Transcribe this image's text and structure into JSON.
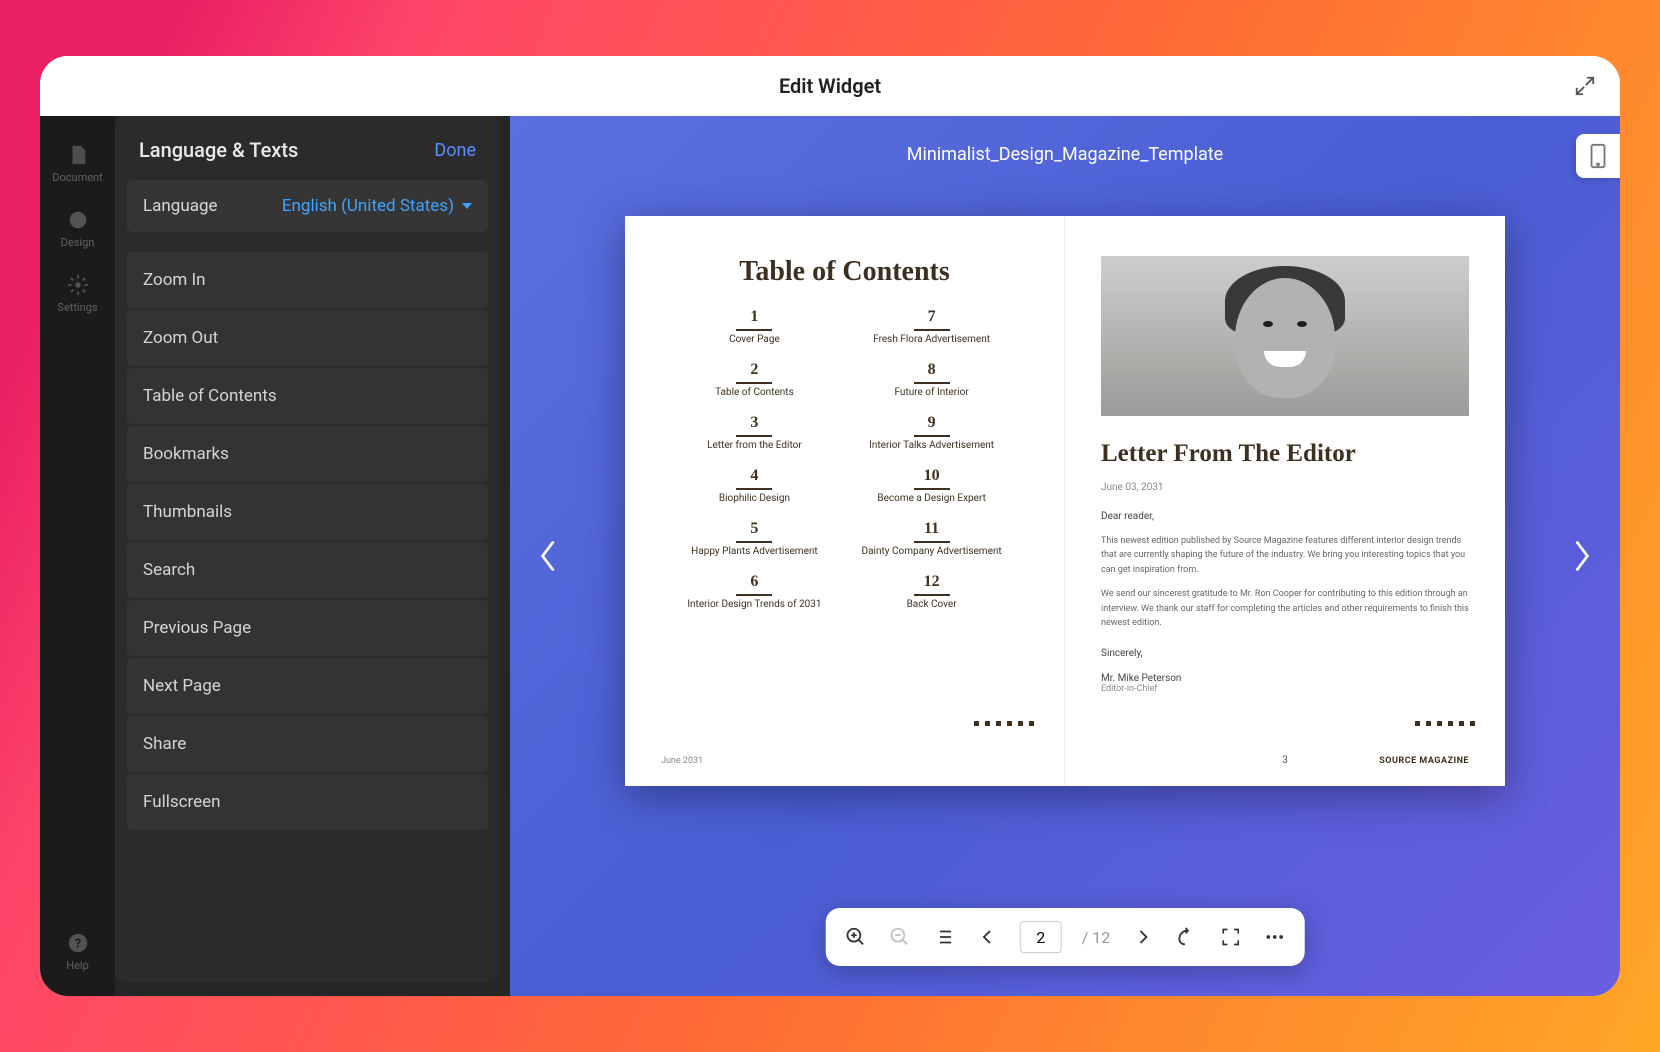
{
  "titlebar": {
    "title": "Edit Widget"
  },
  "rail": {
    "items": [
      {
        "label": "Document"
      },
      {
        "label": "Design"
      },
      {
        "label": "Settings"
      }
    ],
    "help": "Help"
  },
  "panel": {
    "title": "Language & Texts",
    "done": "Done",
    "language_label": "Language",
    "language_value": "English (United States)",
    "texts": [
      "Zoom In",
      "Zoom Out",
      "Table of Contents",
      "Bookmarks",
      "Thumbnails",
      "Search",
      "Previous Page",
      "Next Page",
      "Share",
      "Fullscreen"
    ]
  },
  "viewer": {
    "doc_title": "Minimalist_Design_Magazine_Template",
    "current_page": "2",
    "total_pages": "12",
    "page_sep": "/"
  },
  "spread": {
    "left": {
      "title": "Table of Contents",
      "col1": [
        {
          "n": "1",
          "t": "Cover Page"
        },
        {
          "n": "2",
          "t": "Table of Contents"
        },
        {
          "n": "3",
          "t": "Letter from the Editor"
        },
        {
          "n": "4",
          "t": "Biophilic Design"
        },
        {
          "n": "5",
          "t": "Happy Plants Advertisement"
        },
        {
          "n": "6",
          "t": "Interior Design Trends of 2031"
        }
      ],
      "col2": [
        {
          "n": "7",
          "t": "Fresh Flora Advertisement"
        },
        {
          "n": "8",
          "t": "Future of Interior"
        },
        {
          "n": "9",
          "t": "Interior Talks Advertisement"
        },
        {
          "n": "10",
          "t": "Become a Design Expert"
        },
        {
          "n": "11",
          "t": "Dainty Company Advertisement"
        },
        {
          "n": "12",
          "t": "Back Cover"
        }
      ],
      "footer_date": "June 2031"
    },
    "right": {
      "title": "Letter From The Editor",
      "date": "June 03, 2031",
      "greeting": "Dear reader,",
      "para1": "This newest edition published by Source Magazine features different interior design trends that are currently shaping the future of the industry. We bring you interesting topics that you can get inspiration from.",
      "para2": "We send our sincerest gratitude to Mr. Ron Cooper for contributing to this edition through an interview. We thank our staff for completing the articles and other requirements to finish this newest edition.",
      "closing": "Sincerely,",
      "name": "Mr. Mike Peterson",
      "role": "Editor-in-Chief",
      "page_num": "3",
      "brand": "SOURCE MAGAZINE"
    }
  }
}
